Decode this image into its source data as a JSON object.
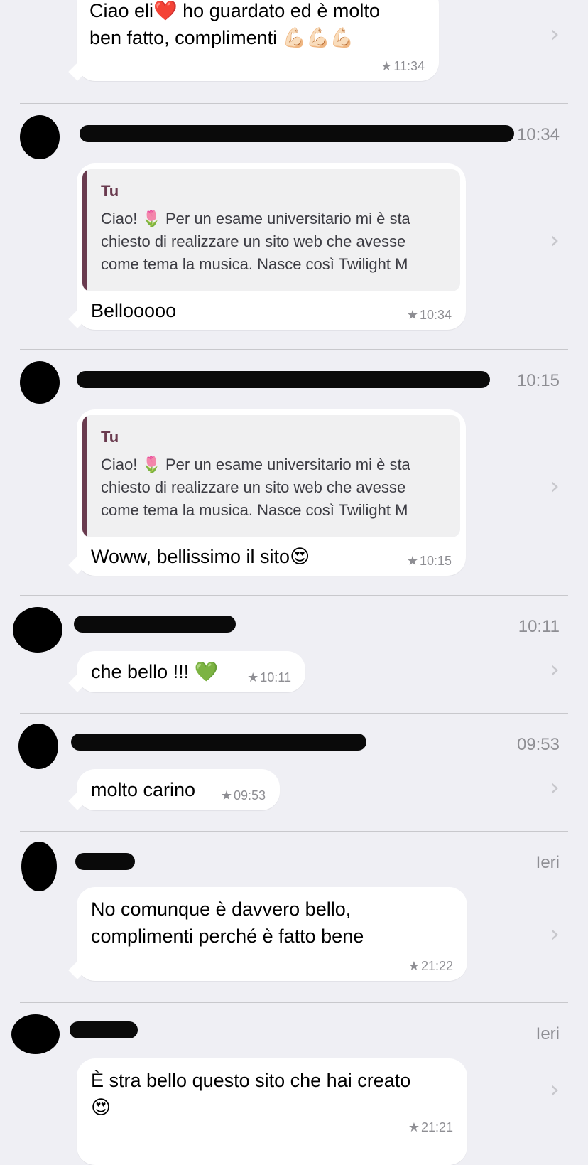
{
  "entries": [
    {
      "message": "Ciao eli❤️ ho guardato ed è molto",
      "message2": "ben fatto, complimenti 💪🏻💪🏻💪🏻",
      "time": "11:34"
    },
    {
      "sender_time": "10:34",
      "quote_name": "Tu",
      "quote_line1": "Ciao! 🌷 Per un esame universitario mi è sta",
      "quote_line2": "chiesto di realizzare un sito web che avesse",
      "quote_line3": "come tema la musica. Nasce così  Twilight M",
      "message": "Bellooooo",
      "time": "10:34"
    },
    {
      "sender_time": "10:15",
      "quote_name": "Tu",
      "quote_line1": "Ciao! 🌷 Per un esame universitario mi è sta",
      "quote_line2": "chiesto di realizzare un sito web che avesse",
      "quote_line3": "come tema la musica. Nasce così  Twilight M",
      "message": "Woww, bellissimo il sito😍",
      "time": "10:15"
    },
    {
      "sender_time": "10:11",
      "message": "che bello !!! 💚",
      "time": "10:11"
    },
    {
      "sender_time": "09:53",
      "message": "molto carino",
      "time": "09:53"
    },
    {
      "sender_time": "Ieri",
      "message": "No comunque è davvero bello,",
      "message2": "complimenti perché è fatto bene",
      "time": "21:22"
    },
    {
      "sender_time": "Ieri",
      "message": "È stra bello questo sito che hai creato",
      "message2": "😍",
      "time": "21:21"
    }
  ],
  "icons": {
    "star": "star-icon",
    "chevron": "chevron-right-icon"
  },
  "colors": {
    "background": "#efeff4",
    "bubble": "#ffffff",
    "quote_accent": "#6a3b4f",
    "secondary_text": "#8e8e93"
  }
}
